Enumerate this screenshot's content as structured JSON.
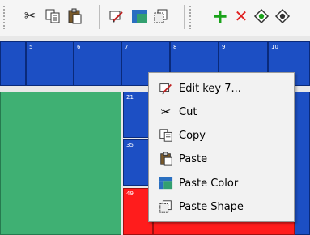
{
  "toolbar": {
    "buttons": [
      {
        "name": "cut-button",
        "icon": "scissors-icon",
        "glyph": "✂"
      },
      {
        "name": "copy-button",
        "icon": "copy-icon",
        "glyph": "⎘"
      },
      {
        "name": "paste-button",
        "icon": "clipboard-icon",
        "glyph": "📋"
      },
      {
        "name": "edit-key-button",
        "icon": "edit-key-icon"
      },
      {
        "name": "paste-color-button",
        "icon": "color-swatch-icon"
      },
      {
        "name": "paste-shape-button",
        "icon": "shape-icon"
      },
      {
        "name": "add-button",
        "icon": "plus-icon",
        "glyph": "+",
        "color": "#1aa31a"
      },
      {
        "name": "delete-button",
        "icon": "x-icon",
        "glyph": "✕",
        "color": "#e02020"
      },
      {
        "name": "diamond-button",
        "icon": "diamond-icon"
      },
      {
        "name": "diamond-button-2",
        "icon": "diamond-icon"
      }
    ]
  },
  "keys": {
    "row1": [
      "5",
      "6",
      "7",
      "8",
      "9",
      "10"
    ],
    "row2": [
      "21"
    ],
    "row3": [
      "35"
    ],
    "row4": [
      "49"
    ]
  },
  "context_menu": {
    "items": [
      {
        "label": "Edit key 7...",
        "icon": "edit-key-icon"
      },
      {
        "label": "Cut",
        "icon": "scissors-icon"
      },
      {
        "label": "Copy",
        "icon": "copy-icon"
      },
      {
        "label": "Paste",
        "icon": "clipboard-icon"
      },
      {
        "label": "Paste Color",
        "icon": "color-swatch-icon"
      },
      {
        "label": "Paste Shape",
        "icon": "shape-icon"
      }
    ]
  },
  "colors": {
    "key_blue": "#1c4fc4",
    "key_green": "#3fb073",
    "key_red": "#ff1c1c",
    "plus_green": "#1aa31a",
    "x_red": "#e02020"
  }
}
